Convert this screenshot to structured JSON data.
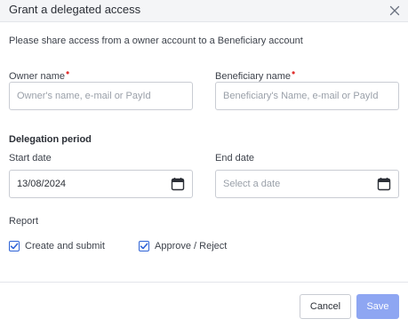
{
  "dialog": {
    "title": "Grant a delegated access",
    "intro": "Please share access from a owner account to a Beneficiary account"
  },
  "owner": {
    "label": "Owner name",
    "required_mark": "•",
    "placeholder": "Owner's name, e-mail or PayId",
    "value": ""
  },
  "beneficiary": {
    "label": "Beneficiary name",
    "required_mark": "•",
    "placeholder": "Beneficiary's Name, e-mail or PayId",
    "value": ""
  },
  "delegation": {
    "section_title": "Delegation period",
    "start_label": "Start date",
    "start_value": "13/08/2024",
    "end_label": "End date",
    "end_placeholder": "Select a date"
  },
  "report": {
    "label": "Report",
    "options": [
      {
        "label": "Create and submit",
        "checked": true
      },
      {
        "label": "Approve / Reject",
        "checked": true
      }
    ]
  },
  "footer": {
    "cancel_label": "Cancel",
    "save_label": "Save"
  },
  "icons": {
    "close": "close-icon",
    "calendar": "calendar-icon",
    "check": "checkmark-icon"
  },
  "colors": {
    "accent": "#2f63d6",
    "save_disabled": "#8ea6f2",
    "required": "#e0312f",
    "header_bg": "#f4f5f7"
  }
}
